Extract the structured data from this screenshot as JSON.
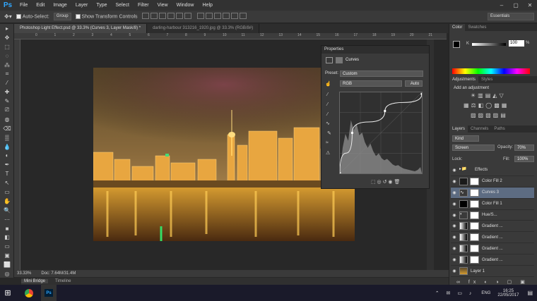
{
  "app": {
    "logo": "Ps"
  },
  "menu": [
    "File",
    "Edit",
    "Image",
    "Layer",
    "Type",
    "Select",
    "Filter",
    "View",
    "Window",
    "Help"
  ],
  "window_controls": [
    "–",
    "▢",
    "✕"
  ],
  "options": {
    "auto_select_label": "Auto-Select:",
    "auto_select_value": "Group",
    "transform_controls": "Show Transform Controls",
    "workspace": "Essentials"
  },
  "tabs": [
    {
      "label": "Photoshop Light Effect.psd @ 33.3% (Curves 3, Layer Mask/8) *"
    },
    {
      "label": "darling-harbour 313216_1920.jpg @ 33.3% (RGB/8#)"
    }
  ],
  "ruler_labels": [
    "0",
    "1",
    "2",
    "3",
    "4",
    "5",
    "6",
    "7",
    "8",
    "9",
    "10",
    "11",
    "12",
    "13",
    "14",
    "15",
    "16",
    "17",
    "18",
    "19",
    "20",
    "21"
  ],
  "status": {
    "zoom": "33.33%",
    "doc": "Doc: 7.64M/31.4M"
  },
  "bridge": {
    "mini_bridge": "Mini Bridge",
    "timeline": "Timeline"
  },
  "properties": {
    "title": "Properties",
    "panel_name": "Curves",
    "preset_label": "Preset:",
    "preset_value": "Custom",
    "channel": "RGB",
    "auto_label": "Auto",
    "curve_points": [
      [
        0,
        0
      ],
      [
        0.15,
        0.5
      ],
      [
        0.55,
        0.77
      ],
      [
        1,
        0.98
      ]
    ]
  },
  "color_panel": {
    "tab_color": "Color",
    "tab_swatches": "Swatches",
    "channel": "K",
    "value": "100",
    "unit": "%"
  },
  "adjustments": {
    "tab_adjustments": "Adjustments",
    "tab_styles": "Styles",
    "heading": "Add an adjustment"
  },
  "layers": {
    "tabs": [
      "Layers",
      "Channels",
      "Paths"
    ],
    "kind": "Kind",
    "blend_mode": "Screen",
    "opacity_label": "Opacity:",
    "opacity": "70%",
    "lock_label": "Lock:",
    "fill_label": "Fill:",
    "fill": "100%",
    "items": [
      {
        "name": "Effects",
        "thumb": "folder"
      },
      {
        "name": "Color Fill 2",
        "thumb": "#1a1a1a"
      },
      {
        "name": "Curves 3",
        "thumb": "curves"
      },
      {
        "name": "Color Fill 1",
        "thumb": "#000000"
      },
      {
        "name": "Hue/S...",
        "thumb": "hue"
      },
      {
        "name": "Gradient ...",
        "thumb": "grad"
      },
      {
        "name": "Gradient ...",
        "thumb": "grad"
      },
      {
        "name": "Gradient ...",
        "thumb": "grad"
      },
      {
        "name": "Gradient ...",
        "thumb": "grad"
      },
      {
        "name": "Layer 1",
        "thumb": "photo"
      }
    ]
  },
  "taskbar": {
    "lang": "ENG",
    "time": "16:25",
    "date": "22/05/2017"
  },
  "colors": {
    "accent": "#31a8ff",
    "selected_layer": "#5d6c82"
  }
}
